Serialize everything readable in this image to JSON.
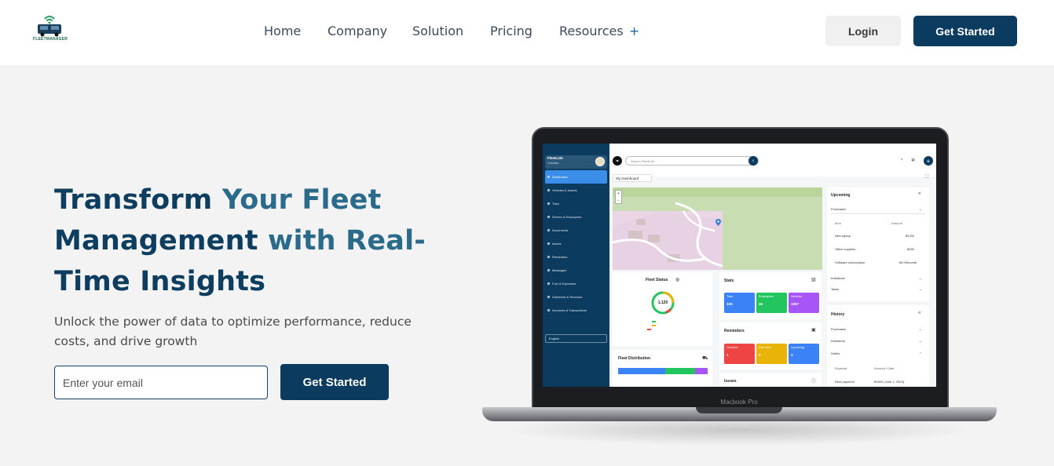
{
  "brand": {
    "logo_text": "FLEETMANAGER"
  },
  "nav": {
    "items": [
      "Home",
      "Company",
      "Solution",
      "Pricing",
      "Resources"
    ],
    "resources_plus": "+"
  },
  "header": {
    "login_label": "Login",
    "get_started_label": "Get Started"
  },
  "hero": {
    "title_part1": "Transform ",
    "title_part2": "Your Fleet",
    "title_part3": "Management ",
    "title_part4": "with Real-",
    "title_part5": "Time Insights",
    "subtitle": "Unlock the power of data to optimize performance, reduce costs, and drive growth",
    "email_placeholder": "Enter your email",
    "cta_label": "Get Started"
  },
  "laptop": {
    "label": "Macbook Pro",
    "app": {
      "profile_name": "FleetLink",
      "profile_role": "Guardian",
      "sidebar_items": [
        "Dashboard",
        "Vehicles & Assets",
        "Trips",
        "Drivers & Employees",
        "Documents",
        "Issues",
        "Reminders",
        "Messages",
        "Fuel & Expenses",
        "Deliveries & Revenue",
        "Accounts & Transactions"
      ],
      "language": "English",
      "search_placeholder": "Search FleetLink",
      "dashboard_select": "My Dashboard",
      "fleet_status": {
        "title": "Fleet Status",
        "total": "1,120"
      },
      "stats": {
        "title": "Stats",
        "tiles": [
          {
            "label": "Trips",
            "value": "326"
          },
          {
            "label": "Employees",
            "value": "46"
          },
          {
            "label": "Vehicles",
            "value": "1067"
          }
        ]
      },
      "reminders": {
        "title": "Reminders",
        "tiles": [
          {
            "label": "Overdue",
            "value": "1"
          },
          {
            "label": "Due soon",
            "value": "0"
          },
          {
            "label": "Upcoming",
            "value": "3"
          }
        ]
      },
      "fleet_distribution": {
        "title": "Fleet Distribution"
      },
      "issues": {
        "title": "Issues"
      },
      "upcoming": {
        "title": "Upcoming",
        "select": "Purchases",
        "col_item": "Item",
        "col_amount": "Amount",
        "rows": [
          {
            "item": "New laptop",
            "amount": "$1200"
          },
          {
            "item": "Office supplies",
            "amount": "$250"
          },
          {
            "item": "Software subscription",
            "amount": "$9.99/month"
          }
        ],
        "invitations": "Invitations",
        "tasks": "Tasks"
      },
      "history": {
        "title": "History",
        "items": [
          "Purchases",
          "Invitations",
          "Debits"
        ],
        "col_expense": "Expense",
        "col_amount": "Amount / Date",
        "row_item": "Rent payment",
        "row_amount": "$1500 (June 1, 2023)"
      }
    }
  },
  "colors": {
    "primary": "#0b3b5e",
    "accent": "#2a6a8a",
    "background": "#f3f3f3"
  }
}
